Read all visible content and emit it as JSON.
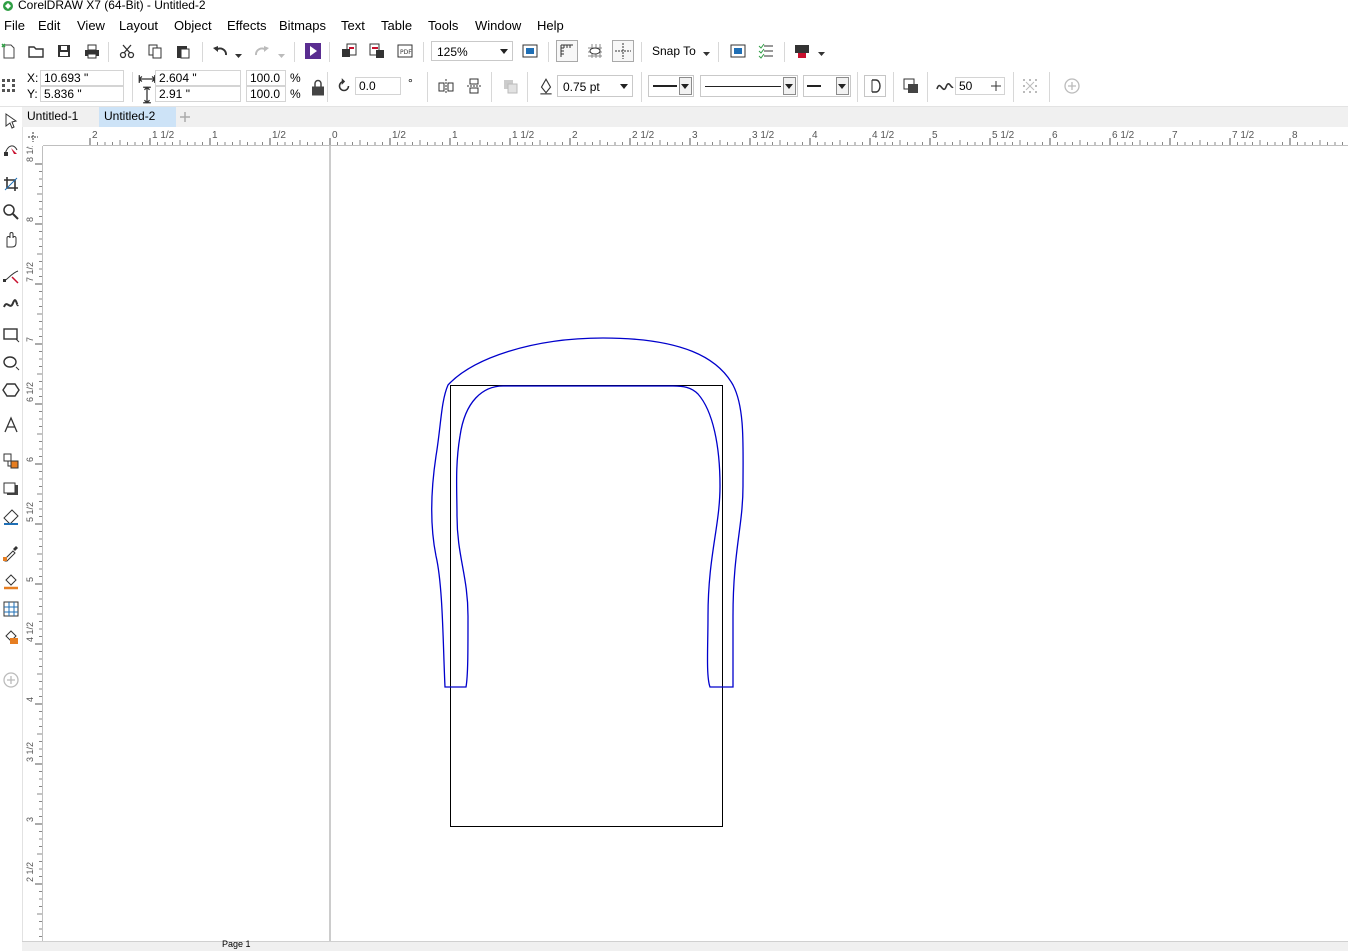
{
  "window": {
    "title": "CorelDRAW X7 (64-Bit) - Untitled-2",
    "app_icon": "coreldraw-logo-icon"
  },
  "menu": {
    "items": [
      {
        "label": "File",
        "accel": "F"
      },
      {
        "label": "Edit",
        "accel": "E"
      },
      {
        "label": "View",
        "accel": "V"
      },
      {
        "label": "Layout",
        "accel": "L"
      },
      {
        "label": "Object",
        "accel": "j"
      },
      {
        "label": "Effects",
        "accel": "C"
      },
      {
        "label": "Bitmaps",
        "accel": "B"
      },
      {
        "label": "Text",
        "accel": "x"
      },
      {
        "label": "Table",
        "accel": "T"
      },
      {
        "label": "Tools",
        "accel": "o"
      },
      {
        "label": "Window",
        "accel": "W"
      },
      {
        "label": "Help",
        "accel": "H"
      }
    ]
  },
  "standard_toolbar": {
    "icons": [
      "new-document-icon",
      "open-icon",
      "save-icon",
      "print-icon",
      "cut-icon",
      "copy-icon",
      "paste-icon",
      "undo-icon",
      "redo-icon",
      "search-content-icon",
      "import-icon",
      "export-icon",
      "publish-pdf-icon"
    ],
    "zoom_level": "125%",
    "snap_to_label": "Snap To",
    "colors": {
      "accent_purple": "#5a2d91",
      "icon_gray": "#444444",
      "launch_red": "#c8102e"
    }
  },
  "property_bar": {
    "x_label": "X:",
    "x_value": "10.693 \"",
    "y_label": "Y:",
    "y_value": "5.836 \"",
    "width_value": "2.604 \"",
    "height_value": "2.91 \"",
    "scale_x": "100.0",
    "scale_y": "100.0",
    "percent_sign": "%",
    "rotation_value": "0.0",
    "degree_sign": "°",
    "outline_width": "0.75 pt",
    "smoothing_value": "50"
  },
  "document_tabs": [
    {
      "label": "Untitled-1",
      "active": false
    },
    {
      "label": "Untitled-2",
      "active": true
    }
  ],
  "rulers": {
    "horizontal_labels": [
      "2",
      "1 1/2",
      "1",
      "1/2",
      "0",
      "1/2",
      "1",
      "1 1/2",
      "2",
      "2 1/2",
      "3",
      "3 1/2",
      "4",
      "4 1/2",
      "5",
      "5 1/2",
      "6",
      "6 1/2",
      "7",
      "7 1/2",
      "8"
    ],
    "vertical_labels": [
      "8 1/2",
      "8",
      "7 1/2",
      "7",
      "6 1/2",
      "6",
      "5 1/2",
      "5",
      "4 1/2",
      "4",
      "3 1/2",
      "3",
      "2 1/2"
    ],
    "units": "inches"
  },
  "toolbox": {
    "tools": [
      "pick-tool-icon",
      "shape-tool-icon",
      "crop-tool-icon",
      "zoom-tool-icon",
      "pan-tool-icon",
      "freehand-tool-icon",
      "artistic-media-icon",
      "rectangle-tool-icon",
      "ellipse-tool-icon",
      "polygon-tool-icon",
      "text-tool-icon",
      "parallel-dimension-icon",
      "drop-shadow-icon",
      "transparency-icon",
      "eyedropper-icon",
      "interactive-fill-icon",
      "mesh-fill-icon",
      "smart-fill-icon",
      "add-tool-icon"
    ]
  },
  "drawing": {
    "rectangle_stroke": "#000000",
    "curve_stroke": "#0000cc"
  },
  "status": {
    "page_label": "Page 1"
  }
}
